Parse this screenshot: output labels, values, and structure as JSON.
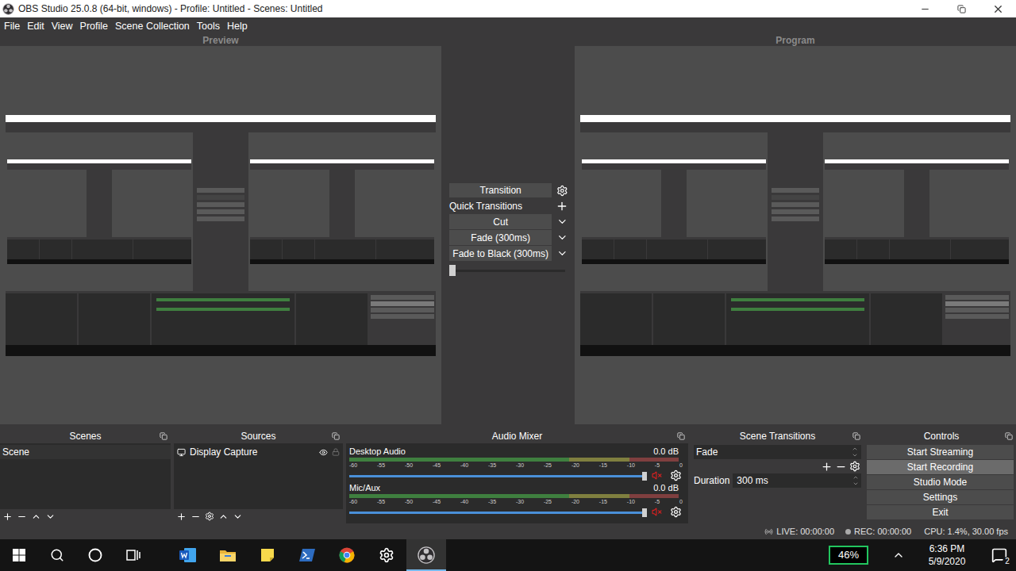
{
  "window": {
    "title": "OBS Studio 25.0.8 (64-bit, windows) - Profile: Untitled - Scenes: Untitled"
  },
  "menu": [
    "File",
    "Edit",
    "View",
    "Profile",
    "Scene Collection",
    "Tools",
    "Help"
  ],
  "preview": {
    "label": "Preview"
  },
  "program": {
    "label": "Program"
  },
  "transition_panel": {
    "button": "Transition",
    "quick_label": "Quick Transitions",
    "quick_transitions": [
      "Cut",
      "Fade (300ms)",
      "Fade to Black (300ms)"
    ],
    "level": 0
  },
  "scenes": {
    "title": "Scenes",
    "items": [
      {
        "label": "Scene",
        "selected": true
      }
    ]
  },
  "sources": {
    "title": "Sources",
    "items": [
      {
        "label": "Display Capture",
        "visible": true,
        "locked": false
      }
    ]
  },
  "audio_mixer": {
    "title": "Audio Mixer",
    "scale": [
      "-60",
      "-55",
      "-50",
      "-45",
      "-40",
      "-35",
      "-30",
      "-25",
      "-20",
      "-15",
      "-10",
      "-5",
      "0"
    ],
    "channels": [
      {
        "name": "Desktop Audio",
        "reading": "0.0 dB",
        "level": 1,
        "muted": true
      },
      {
        "name": "Mic/Aux",
        "reading": "0.0 dB",
        "level": 1,
        "muted": true
      }
    ]
  },
  "scene_transitions": {
    "title": "Scene Transitions",
    "transition": "Fade",
    "duration_label": "Duration",
    "duration": "300 ms"
  },
  "controls": {
    "title": "Controls",
    "buttons": [
      {
        "label": "Start Streaming",
        "hovered": false
      },
      {
        "label": "Start Recording",
        "hovered": true
      },
      {
        "label": "Studio Mode",
        "hovered": false
      },
      {
        "label": "Settings",
        "hovered": false
      },
      {
        "label": "Exit",
        "hovered": false
      }
    ]
  },
  "status_bar": {
    "live": "LIVE: 00:00:00",
    "rec": "REC: 00:00:00",
    "cpu": "CPU: 1.4%, 30.00 fps"
  },
  "taskbar": {
    "apps": [
      {
        "kind": "start",
        "active": false
      },
      {
        "kind": "search",
        "active": false
      },
      {
        "kind": "cortana",
        "active": false
      },
      {
        "kind": "taskview",
        "active": false
      },
      {
        "kind": "word",
        "active": false
      },
      {
        "kind": "explorer",
        "active": false
      },
      {
        "kind": "sticky",
        "active": false
      },
      {
        "kind": "powershell",
        "active": false
      },
      {
        "kind": "chrome",
        "active": false
      },
      {
        "kind": "settings",
        "active": false
      },
      {
        "kind": "obs",
        "active": true
      }
    ],
    "battery": "46%",
    "time": "6:36 PM",
    "date": "5/9/2020",
    "notifications": "2"
  }
}
